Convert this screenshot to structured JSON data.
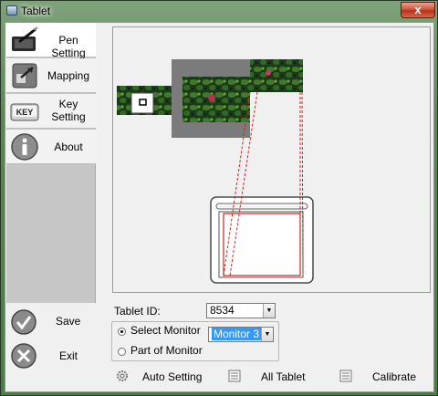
{
  "window": {
    "title": "Tablet",
    "close_glyph": "x"
  },
  "nav": {
    "items": [
      {
        "label": "Pen Setting",
        "icon": "pen-tablet-icon"
      },
      {
        "label": "Mapping",
        "icon": "mapping-icon"
      },
      {
        "label_line1": "Key",
        "label_line2": "Setting",
        "icon": "key-icon"
      },
      {
        "label": "About",
        "icon": "info-icon"
      }
    ],
    "active_index": 0
  },
  "preview": {
    "key_chip_label": "KEY"
  },
  "bottom_actions": {
    "save_label": "Save",
    "exit_label": "Exit"
  },
  "tablet_id": {
    "label": "Tablet ID:",
    "value": "8534"
  },
  "monitor_group": {
    "select_label": "Select Monitor",
    "part_label": "Part of Monitor",
    "selected_option": "select",
    "monitor_value": "Monitor 3"
  },
  "footer": {
    "auto_setting_label": "Auto Setting",
    "all_tablet_label": "All Tablet",
    "calibrate_label": "Calibrate"
  },
  "colors": {
    "mapping_line": "#d42020",
    "selection": "#3399ff",
    "close": "#c8432b"
  }
}
